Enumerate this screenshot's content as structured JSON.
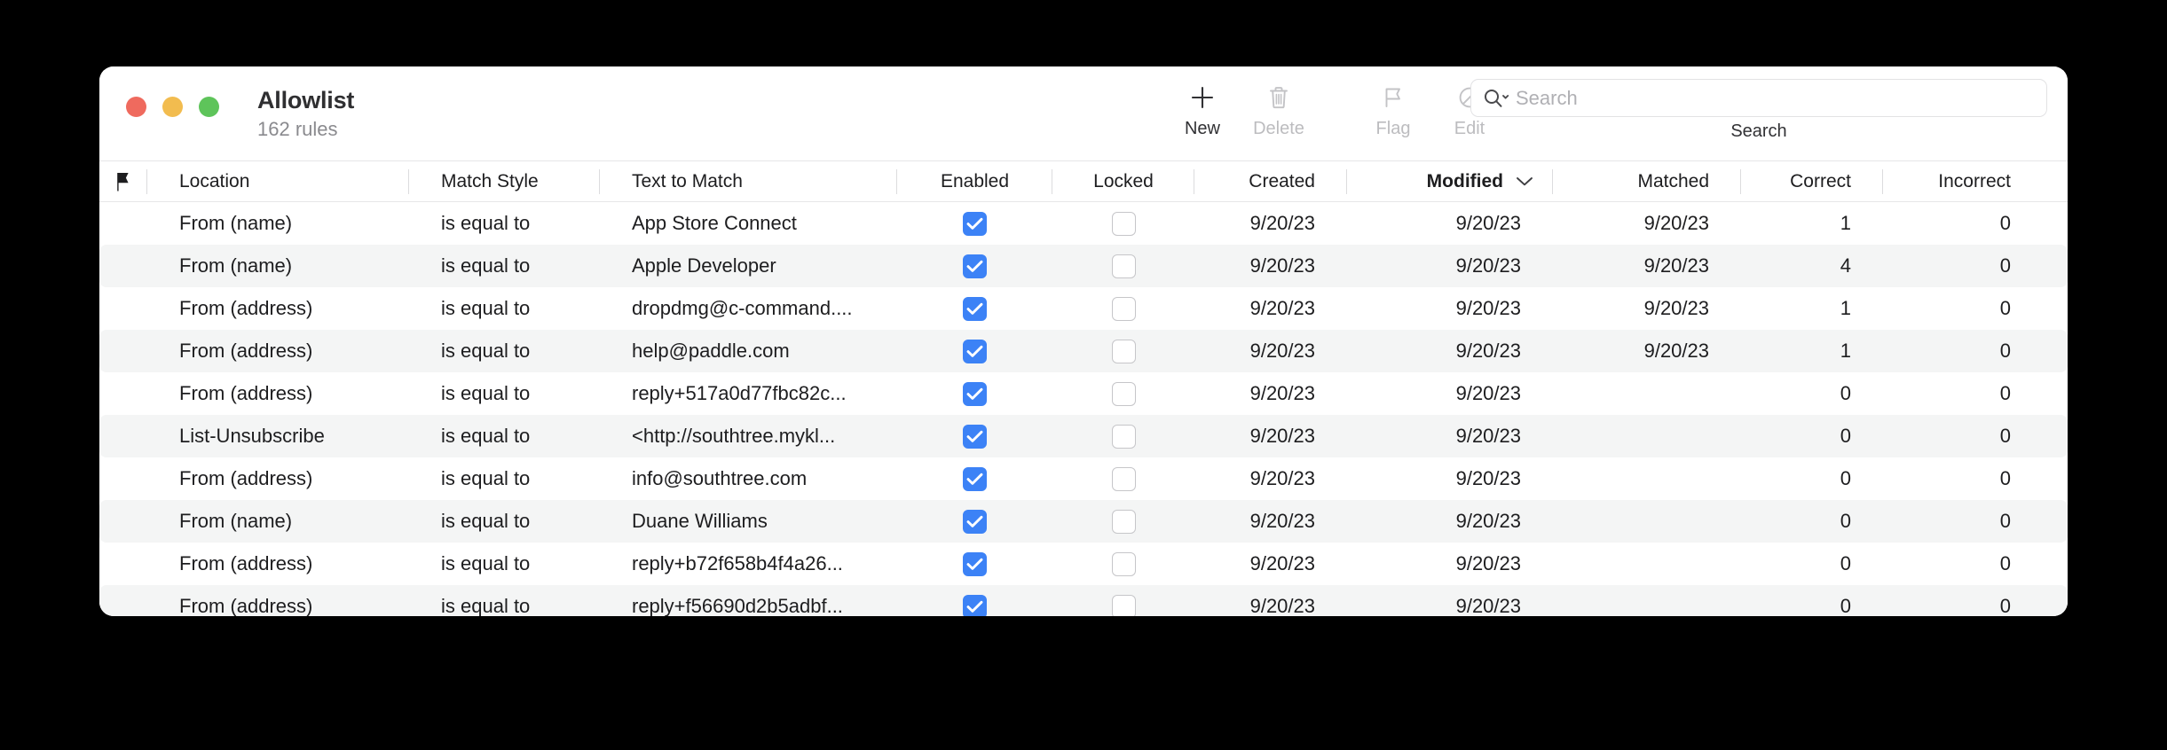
{
  "window": {
    "title": "Allowlist",
    "subtitle": "162 rules",
    "traffic_lights": [
      {
        "name": "close",
        "color": "#ef6a5e"
      },
      {
        "name": "minimize",
        "color": "#f2bc4f"
      },
      {
        "name": "zoom",
        "color": "#5ec45a"
      }
    ]
  },
  "toolbar": {
    "buttons": [
      {
        "label": "New",
        "icon": "plus-icon",
        "enabled": true
      },
      {
        "label": "Delete",
        "icon": "trash-icon",
        "enabled": false
      },
      {
        "label": "Flag",
        "icon": "flag-icon",
        "enabled": false
      },
      {
        "label": "Edit",
        "icon": "no-entry-icon",
        "enabled": false
      }
    ],
    "search": {
      "placeholder": "Search",
      "value": "",
      "caption": "Search",
      "icon": "search-icon"
    }
  },
  "table": {
    "sort_column": "Modified",
    "sort_direction": "descending",
    "columns": [
      {
        "key": "flag",
        "label": "",
        "icon": "flag-icon"
      },
      {
        "key": "location",
        "label": "Location"
      },
      {
        "key": "style",
        "label": "Match Style"
      },
      {
        "key": "text",
        "label": "Text to Match"
      },
      {
        "key": "enabled",
        "label": "Enabled"
      },
      {
        "key": "locked",
        "label": "Locked"
      },
      {
        "key": "created",
        "label": "Created"
      },
      {
        "key": "modified",
        "label": "Modified"
      },
      {
        "key": "matched",
        "label": "Matched"
      },
      {
        "key": "correct",
        "label": "Correct"
      },
      {
        "key": "incorrect",
        "label": "Incorrect"
      }
    ],
    "rows": [
      {
        "location": "From (name)",
        "style": "is equal to",
        "text": "App Store Connect",
        "enabled": true,
        "locked": false,
        "created": "9/20/23",
        "modified": "9/20/23",
        "matched": "9/20/23",
        "correct": "1",
        "incorrect": "0"
      },
      {
        "location": "From (name)",
        "style": "is equal to",
        "text": "Apple Developer",
        "enabled": true,
        "locked": false,
        "created": "9/20/23",
        "modified": "9/20/23",
        "matched": "9/20/23",
        "correct": "4",
        "incorrect": "0"
      },
      {
        "location": "From (address)",
        "style": "is equal to",
        "text": "dropdmg@c-command....",
        "enabled": true,
        "locked": false,
        "created": "9/20/23",
        "modified": "9/20/23",
        "matched": "9/20/23",
        "correct": "1",
        "incorrect": "0"
      },
      {
        "location": "From (address)",
        "style": "is equal to",
        "text": "help@paddle.com",
        "enabled": true,
        "locked": false,
        "created": "9/20/23",
        "modified": "9/20/23",
        "matched": "9/20/23",
        "correct": "1",
        "incorrect": "0"
      },
      {
        "location": "From (address)",
        "style": "is equal to",
        "text": "reply+517a0d77fbc82c...",
        "enabled": true,
        "locked": false,
        "created": "9/20/23",
        "modified": "9/20/23",
        "matched": "",
        "correct": "0",
        "incorrect": "0"
      },
      {
        "location": "List-Unsubscribe",
        "style": "is equal to",
        "text": " <http://southtree.mykl...",
        "enabled": true,
        "locked": false,
        "created": "9/20/23",
        "modified": "9/20/23",
        "matched": "",
        "correct": "0",
        "incorrect": "0"
      },
      {
        "location": "From (address)",
        "style": "is equal to",
        "text": "info@southtree.com",
        "enabled": true,
        "locked": false,
        "created": "9/20/23",
        "modified": "9/20/23",
        "matched": "",
        "correct": "0",
        "incorrect": "0"
      },
      {
        "location": "From (name)",
        "style": "is equal to",
        "text": "Duane Williams",
        "enabled": true,
        "locked": false,
        "created": "9/20/23",
        "modified": "9/20/23",
        "matched": "",
        "correct": "0",
        "incorrect": "0"
      },
      {
        "location": "From (address)",
        "style": "is equal to",
        "text": "reply+b72f658b4f4a26...",
        "enabled": true,
        "locked": false,
        "created": "9/20/23",
        "modified": "9/20/23",
        "matched": "",
        "correct": "0",
        "incorrect": "0"
      },
      {
        "location": "From (address)",
        "style": "is equal to",
        "text": "reply+f56690d2b5adbf...",
        "enabled": true,
        "locked": false,
        "created": "9/20/23",
        "modified": "9/20/23",
        "matched": "",
        "correct": "0",
        "incorrect": "0"
      }
    ]
  },
  "colors": {
    "accent": "#3c82f6",
    "row_alt": "#f4f5f5",
    "text": "#1d1d1f",
    "muted": "#8a8a8e",
    "disabled": "#bcbcbf"
  }
}
